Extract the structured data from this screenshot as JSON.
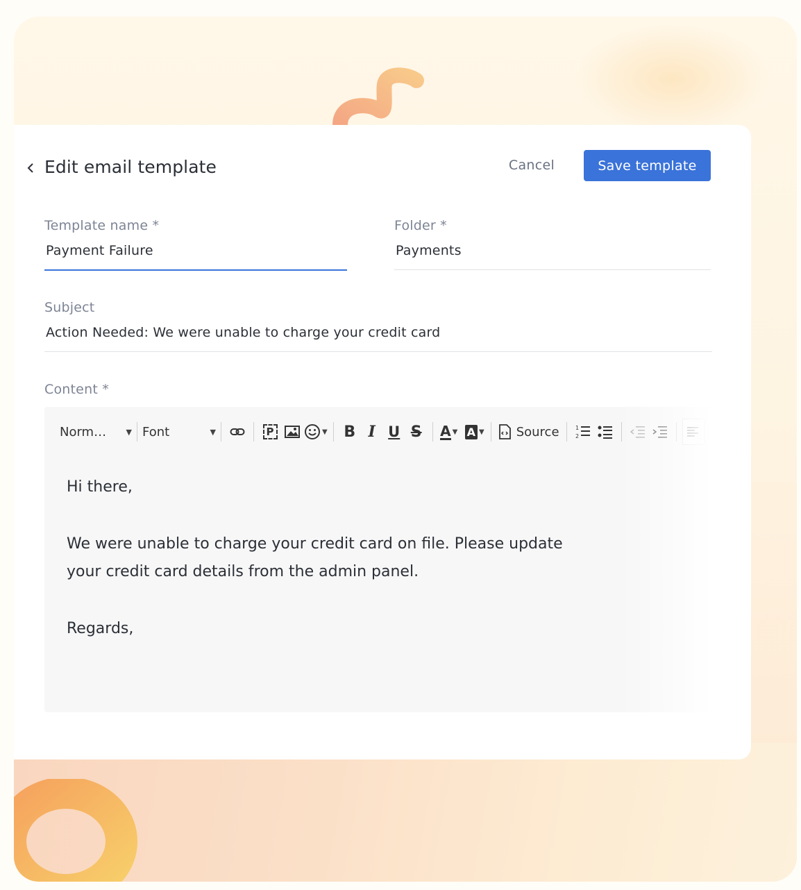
{
  "header": {
    "title": "Edit email template",
    "cancel_label": "Cancel",
    "save_label": "Save template"
  },
  "form": {
    "template_name": {
      "label": "Template name *",
      "value": "Payment Failure"
    },
    "folder": {
      "label": "Folder *",
      "value": "Payments"
    },
    "subject": {
      "label": "Subject",
      "value": "Action Needed: We were unable to charge your credit card"
    },
    "content": {
      "label": "Content *"
    }
  },
  "toolbar": {
    "format_value": "Norm…",
    "font_value": "Font",
    "source_label": "Source",
    "bold": "B",
    "italic": "I",
    "underline": "U",
    "strike": "S",
    "text_color": "A",
    "bg_color": "A",
    "placeholder": "P"
  },
  "editor": {
    "lines": [
      "Hi there,",
      "We were unable to charge your credit card on file. Please update",
      "your credit card details from the admin panel.",
      "Regards,"
    ]
  },
  "colors": {
    "accent": "#3a73d9",
    "text": "#2b2f36",
    "label": "#7d8494"
  }
}
